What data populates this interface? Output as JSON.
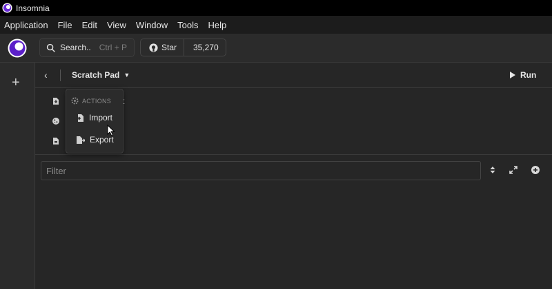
{
  "window": {
    "title": "Insomnia"
  },
  "menubar": {
    "items": [
      "Application",
      "File",
      "Edit",
      "View",
      "Window",
      "Tools",
      "Help"
    ]
  },
  "toolbar": {
    "search_label": "Search..",
    "search_shortcut": "Ctrl + P",
    "github_star_label": "Star",
    "github_star_count": "35,270"
  },
  "header": {
    "project_name": "Scratch Pad",
    "run_label": "Run"
  },
  "items": {
    "partial_text": "t"
  },
  "filter": {
    "placeholder": "Filter"
  },
  "dropdown": {
    "section_label": "ACTIONS",
    "options": [
      {
        "label": "Import",
        "icon": "import-icon"
      },
      {
        "label": "Export",
        "icon": "export-icon"
      }
    ]
  },
  "colors": {
    "brand": "#7b3fe4",
    "background": "#262626",
    "titlebar": "#000000"
  }
}
